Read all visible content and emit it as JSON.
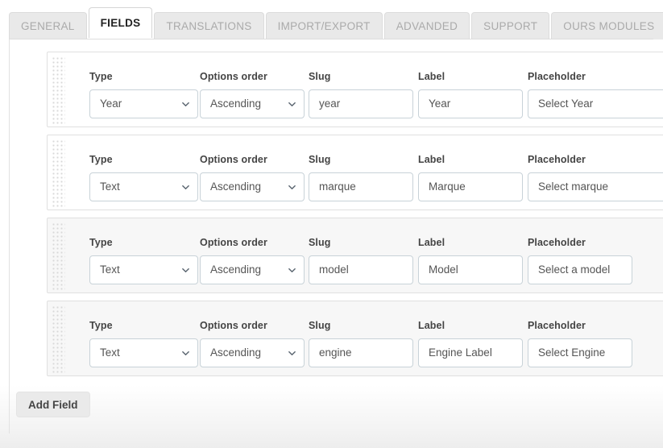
{
  "tabs": [
    {
      "label": "GENERAL",
      "active": false
    },
    {
      "label": "FIELDS",
      "active": true
    },
    {
      "label": "TRANSLATIONS",
      "active": false
    },
    {
      "label": "IMPORT/EXPORT",
      "active": false
    },
    {
      "label": "ADVANDED",
      "active": false
    },
    {
      "label": "SUPPORT",
      "active": false
    },
    {
      "label": "OURS MODULES",
      "active": false
    }
  ],
  "column_headers": {
    "type": "Type",
    "options_order": "Options order",
    "slug": "Slug",
    "label": "Label",
    "placeholder": "Placeholder"
  },
  "fields": [
    {
      "type": "Year",
      "options_order": "Ascending",
      "slug": "year",
      "label": "Year",
      "placeholder": "Select Year",
      "shaded": false,
      "wide": true
    },
    {
      "type": "Text",
      "options_order": "Ascending",
      "slug": "marque",
      "label": "Marque",
      "placeholder": "Select marque",
      "shaded": false,
      "wide": true
    },
    {
      "type": "Text",
      "options_order": "Ascending",
      "slug": "model",
      "label": "Model",
      "placeholder": "Select a model",
      "shaded": true,
      "wide": false
    },
    {
      "type": "Text",
      "options_order": "Ascending",
      "slug": "engine",
      "label": "Engine Label",
      "placeholder": "Select Engine",
      "shaded": true,
      "wide": false
    }
  ],
  "buttons": {
    "add_field": "Add Field"
  },
  "icons": {
    "chevron_down": "chevron-down-icon",
    "drag_handle": "drag-handle-icon"
  },
  "colors": {
    "tab_active_bg": "#ffffff",
    "tab_inactive_bg": "#e9e9e9",
    "tab_inactive_text": "#aaaaaa",
    "input_border": "#c8d2d8",
    "row_border": "#e0e0e0",
    "row_shaded_bg": "#f7f7f7",
    "button_bg": "#eaeaea"
  }
}
